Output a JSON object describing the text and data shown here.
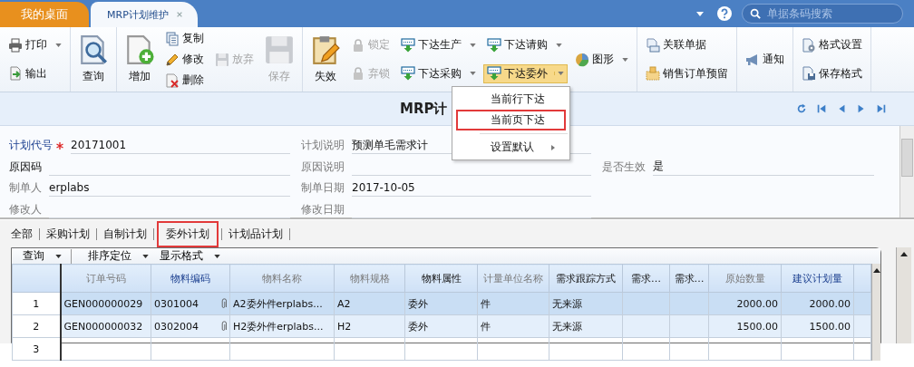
{
  "tabs": [
    {
      "label": "我的桌面",
      "selected": false
    },
    {
      "label": "MRP计划维护",
      "selected": true
    }
  ],
  "search": {
    "placeholder": "单据条码搜索"
  },
  "toolbar": [
    [
      [
        {
          "label": "打印",
          "kind": "small",
          "dropdown": true,
          "disabled": false
        },
        {
          "label": "输出",
          "kind": "small",
          "dropdown": false,
          "disabled": false
        }
      ]
    ],
    [
      [
        {
          "label": "查询",
          "kind": "large",
          "dropdown": false,
          "disabled": false
        }
      ]
    ],
    [
      [
        {
          "label": "增加",
          "kind": "large",
          "dropdown": false,
          "disabled": false
        }
      ],
      [
        {
          "label": "复制",
          "kind": "small",
          "dropdown": false,
          "disabled": false
        },
        {
          "label": "修改",
          "kind": "small",
          "dropdown": false,
          "disabled": false
        },
        {
          "label": "删除",
          "kind": "small",
          "dropdown": false,
          "disabled": false
        }
      ],
      [
        {
          "label": "放弃",
          "kind": "small",
          "dropdown": false,
          "disabled": true
        }
      ],
      [
        {
          "label": "保存",
          "kind": "large",
          "dropdown": false,
          "disabled": true
        }
      ]
    ],
    [
      [
        {
          "label": "失效",
          "kind": "large",
          "dropdown": false,
          "disabled": false
        }
      ],
      [
        {
          "label": "锁定",
          "kind": "small",
          "dropdown": false,
          "disabled": true
        },
        {
          "label": "弃锁",
          "kind": "small",
          "dropdown": false,
          "disabled": true
        }
      ],
      [
        {
          "label": "下达生产",
          "kind": "small",
          "dropdown": true,
          "disabled": false
        },
        {
          "label": "下达采购",
          "kind": "small",
          "dropdown": true,
          "disabled": false
        }
      ],
      [
        {
          "label": "下达请购",
          "kind": "small",
          "dropdown": true,
          "disabled": false
        },
        {
          "label": "下达委外",
          "kind": "small",
          "dropdown": true,
          "disabled": false,
          "pressed": true
        }
      ],
      [
        {
          "label": "图形",
          "kind": "small",
          "dropdown": true,
          "disabled": false
        }
      ]
    ],
    [
      [
        {
          "label": "关联单据",
          "kind": "small",
          "dropdown": false,
          "disabled": false
        },
        {
          "label": "销售订单预留",
          "kind": "small",
          "dropdown": false,
          "disabled": false
        }
      ]
    ],
    [
      [
        {
          "label": "通知",
          "kind": "small",
          "dropdown": false,
          "disabled": false
        }
      ]
    ],
    [
      [
        {
          "label": "格式设置",
          "kind": "small",
          "dropdown": false,
          "disabled": false
        },
        {
          "label": "保存格式",
          "kind": "small",
          "dropdown": false,
          "disabled": false
        }
      ]
    ]
  ],
  "dropdown_menu": {
    "items": [
      {
        "kind": "item",
        "label": "当前行下达",
        "highlighted": false
      },
      {
        "kind": "item",
        "label": "当前页下达",
        "highlighted": true
      },
      {
        "kind": "separator"
      },
      {
        "kind": "submenu",
        "label": "设置默认",
        "highlighted": false
      }
    ]
  },
  "title": "MRP计",
  "form": {
    "rows": [
      [
        {
          "label": "计划代号",
          "kind": "key",
          "required": true,
          "value": "20171001"
        },
        {
          "label": "计划说明",
          "kind": "muted",
          "required": false,
          "value": "预测单毛需求计"
        },
        null
      ],
      [
        {
          "label": "原因码",
          "kind": "strong",
          "required": false
        },
        {
          "label": "原因说明",
          "kind": "muted",
          "required": false
        },
        {
          "label": "是否生效",
          "kind": "muted",
          "required": false,
          "value": "是"
        }
      ],
      [
        {
          "label": "制单人",
          "kind": "muted",
          "required": false,
          "value": "erplabs"
        },
        {
          "label": "制单日期",
          "kind": "muted",
          "required": false,
          "value": "2017-10-05"
        },
        null
      ],
      [
        {
          "label": "修改人",
          "kind": "muted",
          "required": false
        },
        {
          "label": "修改日期",
          "kind": "muted",
          "required": false
        },
        null
      ]
    ]
  },
  "subtabs": [
    {
      "label": "全部",
      "selected": false,
      "highlighted": false
    },
    {
      "label": "采购计划",
      "selected": false,
      "highlighted": false
    },
    {
      "label": "自制计划",
      "selected": false,
      "highlighted": false
    },
    {
      "label": "委外计划",
      "selected": true,
      "highlighted": true
    },
    {
      "label": "计划品计划",
      "selected": false,
      "highlighted": false
    }
  ],
  "grid_toolbar": [
    {
      "label": "查询",
      "dropdown": true
    },
    {
      "label": "排序定位",
      "dropdown": true
    },
    {
      "label": "显示格式",
      "dropdown": true
    }
  ],
  "table": {
    "columns": [
      {
        "label": "订单号码",
        "kind": "muted"
      },
      {
        "label": "物料编码",
        "kind": "key"
      },
      {
        "label": "物料名称",
        "kind": "muted"
      },
      {
        "label": "物料规格",
        "kind": "muted"
      },
      {
        "label": "物料属性",
        "kind": "strong"
      },
      {
        "label": "计量单位名称",
        "kind": "muted"
      },
      {
        "label": "需求跟踪方式",
        "kind": "strong"
      },
      {
        "label": "需求…",
        "kind": "strong"
      },
      {
        "label": "需求…",
        "kind": "strong"
      },
      {
        "label": "原始数量",
        "kind": "muted"
      },
      {
        "label": "建议计划量",
        "kind": "key"
      }
    ],
    "rows": [
      {
        "number": "1",
        "selected": true,
        "attachment": true,
        "cells": [
          "GEN000000029",
          "0301004",
          "A2委外件erplabs...",
          "A2",
          "委外",
          "件",
          "无来源",
          "",
          "",
          "2000.00",
          "2000.00"
        ]
      },
      {
        "number": "2",
        "selected": false,
        "attachment": true,
        "cells": [
          "GEN000000032",
          "0302004",
          "H2委外件erplabs...",
          "H2",
          "委外",
          "件",
          "无来源",
          "",
          "",
          "1500.00",
          "1500.00"
        ]
      },
      {
        "number": "3",
        "selected": false,
        "attachment": false,
        "cells": []
      }
    ]
  }
}
